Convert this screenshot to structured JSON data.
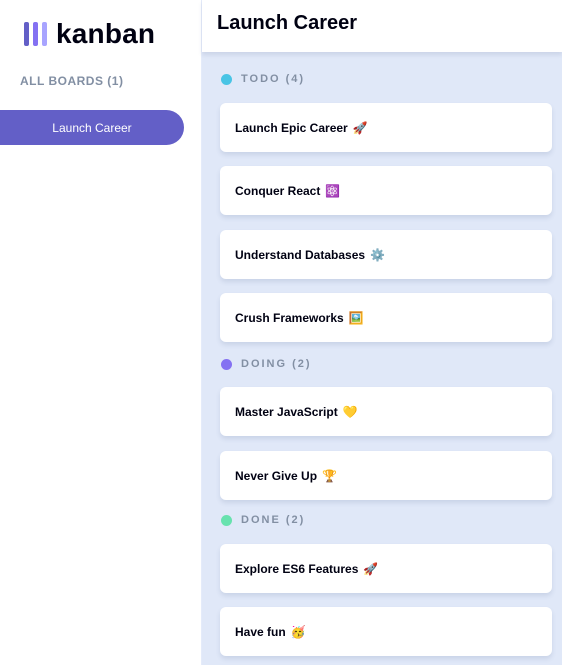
{
  "app": {
    "logo_text": "kanban",
    "logo_bar_colors": [
      "#635fc7",
      "#8471f2",
      "#a8a4ff"
    ]
  },
  "sidebar": {
    "all_boards_label": "ALL BOARDS (1)",
    "boards": [
      {
        "label": "Launch Career",
        "active": true
      }
    ]
  },
  "header": {
    "board_title": "Launch Career"
  },
  "columns": [
    {
      "name": "TODO (4)",
      "dot_color": "#49c4e5",
      "cards": [
        {
          "title": "Launch Epic Career",
          "emoji": "🚀"
        },
        {
          "title": "Conquer React",
          "emoji": "⚛️"
        },
        {
          "title": "Understand Databases",
          "emoji": "⚙️"
        },
        {
          "title": "Crush Frameworks",
          "emoji": "🖼️"
        }
      ]
    },
    {
      "name": "DOING (2)",
      "dot_color": "#8471f2",
      "cards": [
        {
          "title": "Master JavaScript",
          "emoji": "💛"
        },
        {
          "title": "Never Give Up",
          "emoji": "🏆"
        }
      ]
    },
    {
      "name": "DONE (2)",
      "dot_color": "#67e2ae",
      "cards": [
        {
          "title": "Explore ES6 Features",
          "emoji": "🚀"
        },
        {
          "title": "Have fun",
          "emoji": "🥳"
        }
      ]
    }
  ]
}
